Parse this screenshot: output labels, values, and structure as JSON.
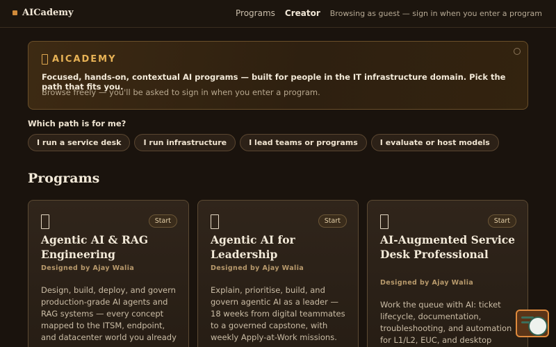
{
  "header": {
    "brand": "AICademy",
    "nav": [
      "Programs",
      "Creator"
    ],
    "guest_text": "Browsing as guest — sign in when you enter a program"
  },
  "hero": {
    "title": "AICADEMY",
    "text": "Focused, hands-on, contextual AI programs — built for people in the IT infrastructure domain. Pick the path that fits you.",
    "subtext": "Browse freely — you'll be asked to sign in when you enter a program."
  },
  "paths": {
    "question": "Which path is for me?",
    "options": [
      "I run a service desk",
      "I run infrastructure",
      "I lead teams or programs",
      "I evaluate or host models"
    ]
  },
  "programs": {
    "heading": "Programs",
    "cards": [
      {
        "title": "Agentic AI & RAG Engineering",
        "designed_by": "Designed by Ajay Walia",
        "description": "Design, build, deploy, and govern production-grade AI agents and RAG systems — every concept mapped to the ITSM, endpoint, and datacenter world you already run.",
        "start": "Start"
      },
      {
        "title": "Agentic AI for Leadership",
        "designed_by": "Designed by Ajay Walia",
        "description": "Explain, prioritise, build, and govern agentic AI as a leader — 18 weeks from digital teammates to a governed capstone, with weekly Apply-at-Work missions.",
        "start": "Start"
      },
      {
        "title": "AI-Augmented Service Desk Professional",
        "designed_by": "Designed by Ajay Walia",
        "description": "Work the queue with AI: ticket lifecycle, documentation, troubleshooting, and automation for L1/L2, EUC, and desktop support",
        "start": "Start"
      }
    ]
  },
  "icons": {
    "brand": "brand-square-icon",
    "hero": "book-icon",
    "card": "book-icon",
    "dismiss": "settings-icon",
    "chat": "chat-assistant-icon"
  },
  "colors": {
    "accent": "#e7b255",
    "background": "#1a130d",
    "card_border": "#5c4a33"
  }
}
